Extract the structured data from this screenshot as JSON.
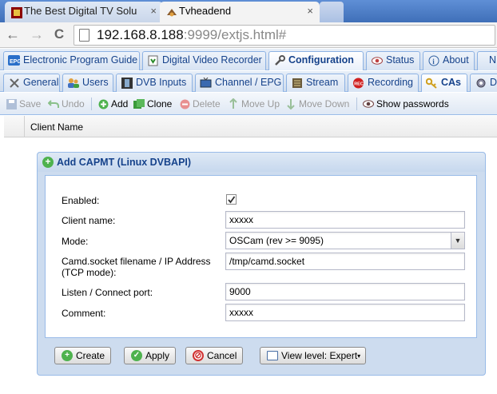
{
  "browser": {
    "tabs": [
      {
        "title": "The Best Digital TV Solu",
        "active": false
      },
      {
        "title": "Tvheadend",
        "active": true
      }
    ],
    "close_glyph": "×",
    "url_host": "192.168.8.188",
    "url_rest": ":9999/extjs.html#",
    "nav_back": "←",
    "nav_forward": "→",
    "nav_reload": "C"
  },
  "main_tabs": [
    {
      "label": "Electronic Program Guide",
      "icon": "epg-icon"
    },
    {
      "label": "Digital Video Recorder",
      "icon": "dvr-icon"
    },
    {
      "label": "Configuration",
      "icon": "wrench-icon",
      "selected": true
    },
    {
      "label": "Status",
      "icon": "eye-icon"
    },
    {
      "label": "About",
      "icon": "info-icon"
    },
    {
      "label": "N",
      "icon": ""
    }
  ],
  "config_tabs": [
    {
      "label": "General",
      "icon": "tools-icon"
    },
    {
      "label": "Users",
      "icon": "users-icon"
    },
    {
      "label": "DVB Inputs",
      "icon": "film-icon"
    },
    {
      "label": "Channel / EPG",
      "icon": "tv-icon"
    },
    {
      "label": "Stream",
      "icon": "stream-icon"
    },
    {
      "label": "Recording",
      "icon": "rec-icon"
    },
    {
      "label": "CAs",
      "icon": "key-icon",
      "selected": true
    },
    {
      "label": "D",
      "icon": "gear-icon"
    }
  ],
  "toolbar": {
    "save": "Save",
    "undo": "Undo",
    "add": "Add",
    "clone": "Clone",
    "delete": "Delete",
    "move_up": "Move Up",
    "move_down": "Move Down",
    "show_passwords": "Show passwords"
  },
  "grid": {
    "columns": [
      "Client Name"
    ]
  },
  "dialog": {
    "title": "Add CAPMT (Linux DVBAPI)",
    "fields": {
      "enabled_label": "Enabled:",
      "enabled_checked": true,
      "client_name_label": "Client name:",
      "client_name_value": "xxxxx",
      "mode_label": "Mode:",
      "mode_value": "OSCam (rev >= 9095)",
      "camd_label": "Camd.socket filename / IP Address (TCP mode):",
      "camd_value": "/tmp/camd.socket",
      "port_label": "Listen / Connect port:",
      "port_value": "9000",
      "comment_label": "Comment:",
      "comment_value": "xxxxx"
    },
    "buttons": {
      "create": "Create",
      "apply": "Apply",
      "cancel": "Cancel",
      "view_level": "View level: Expert"
    }
  },
  "colors": {
    "tab_strip": "#4f80c9",
    "ext_blue": "#15428b",
    "panel_border": "#99bbe8",
    "dialog_bg": "#cddcef"
  }
}
